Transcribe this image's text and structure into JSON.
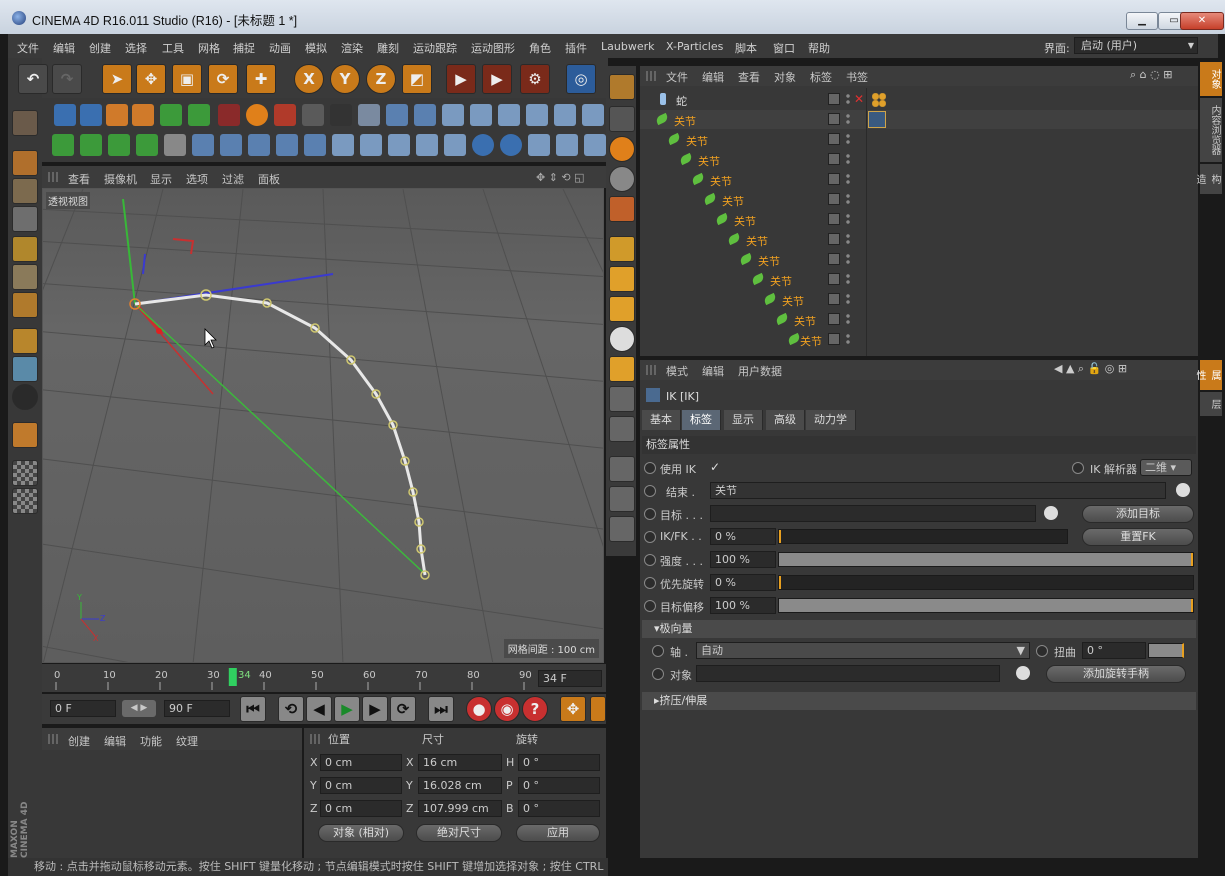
{
  "window": {
    "title": "CINEMA 4D R16.011 Studio (R16) - [未标题 1 *]"
  },
  "menu": {
    "items": [
      "文件",
      "编辑",
      "创建",
      "选择",
      "工具",
      "网格",
      "捕捉",
      "动画",
      "模拟",
      "渲染",
      "雕刻",
      "运动跟踪",
      "运动图形",
      "角色",
      "插件",
      "Laubwerk",
      "X-Particles",
      "脚本",
      "窗口",
      "帮助"
    ],
    "layout_label": "界面:",
    "layout_value": "启动 (用户)"
  },
  "toolbar": {
    "axis_x": "X",
    "axis_y": "Y",
    "axis_z": "Z"
  },
  "viewport": {
    "menu": [
      "查看",
      "摄像机",
      "显示",
      "选项",
      "过滤",
      "面板"
    ],
    "view_name": "透视视图",
    "grid_info": "网格间距 : 100 cm"
  },
  "timeline": {
    "ticks": [
      "0",
      "10",
      "20",
      "30",
      "34",
      "40",
      "50",
      "60",
      "70",
      "80",
      "90"
    ],
    "current": "34 F",
    "start": "0 F",
    "end": "90 F",
    "playhead_frame": 34,
    "max_frame": 90
  },
  "material": {
    "menu": [
      "创建",
      "编辑",
      "功能",
      "纹理"
    ]
  },
  "coords": {
    "headers": [
      "位置",
      "尺寸",
      "旋转"
    ],
    "rows": [
      {
        "axis": "X",
        "pos": "0 cm",
        "saxis": "X",
        "size": "16 cm",
        "raxis": "H",
        "rot": "0 °"
      },
      {
        "axis": "Y",
        "pos": "0 cm",
        "saxis": "Y",
        "size": "16.028 cm",
        "raxis": "P",
        "rot": "0 °"
      },
      {
        "axis": "Z",
        "pos": "0 cm",
        "saxis": "Z",
        "size": "107.999 cm",
        "raxis": "B",
        "rot": "0 °"
      }
    ],
    "mode": "对象 (相对)",
    "size_mode": "绝对尺寸",
    "apply": "应用"
  },
  "status": {
    "text": "移动 : 点击并拖动鼠标移动元素。按住 SHIFT 键量化移动 ; 节点编辑模式时按住 SHIFT 键增加选择对象 ; 按住 CTRL"
  },
  "object_manager": {
    "menu": [
      "文件",
      "编辑",
      "查看",
      "对象",
      "标签",
      "书签"
    ],
    "root": "蛇",
    "items": [
      "关节",
      "关节",
      "关节",
      "关节",
      "关节",
      "关节",
      "关节",
      "关节",
      "关节",
      "关节",
      "关节",
      "关节"
    ]
  },
  "attributes": {
    "menu": [
      "模式",
      "编辑",
      "用户数据"
    ],
    "object": "IK [IK]",
    "tabs": [
      "基本",
      "标签",
      "显示",
      "高级",
      "动力学"
    ],
    "active_tab": 1,
    "section": "标签属性",
    "use_ik_label": "使用 IK",
    "solver_label": "IK 解析器",
    "solver_value": "二维",
    "end_label": "结束 .",
    "end_value": "关节",
    "target_label": "目标 . . .",
    "add_target": "添加目标",
    "ikfk_label": "IK/FK . .",
    "ikfk_value": "0 %",
    "reset_fk": "重置FK",
    "strength_label": "强度 . . .",
    "strength_value": "100 %",
    "strength_level": 1.0,
    "priority_label": "优先旋转",
    "priority_value": "0 %",
    "offset_label": "目标偏移",
    "offset_value": "100 %",
    "offset_level": 1.0,
    "pole_section": "极向量",
    "axis_label": "轴 .",
    "axis_value": "自动",
    "twist_label": "扭曲",
    "twist_value": "0 °",
    "object_label": "对象",
    "add_pole": "添加旋转手柄",
    "squash_section": "挤压/伸展"
  },
  "side_tabs": {
    "right": [
      "对象",
      "内容浏览器",
      "构造"
    ],
    "right2": [
      "属性",
      "层"
    ]
  },
  "brand": "MAXON CINEMA 4D"
}
